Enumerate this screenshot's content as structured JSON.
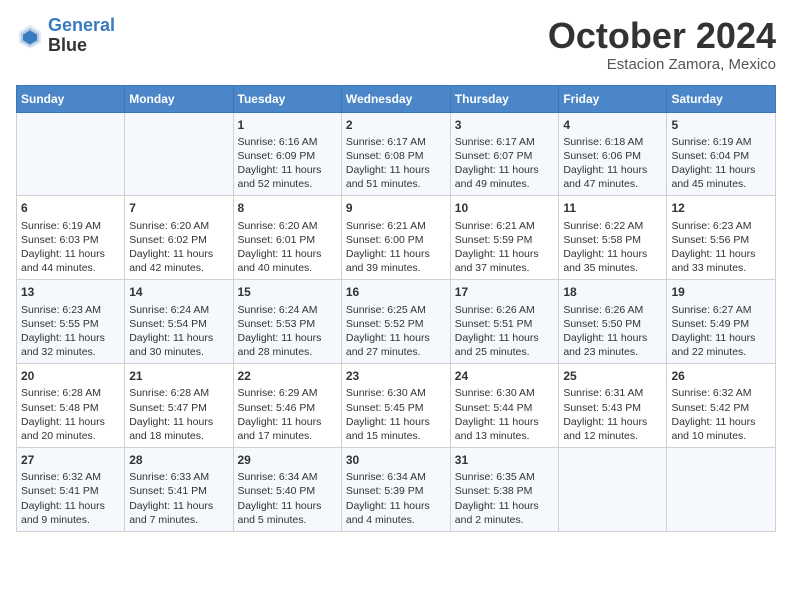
{
  "header": {
    "logo_line1": "General",
    "logo_line2": "Blue",
    "month": "October 2024",
    "location": "Estacion Zamora, Mexico"
  },
  "days_of_week": [
    "Sunday",
    "Monday",
    "Tuesday",
    "Wednesday",
    "Thursday",
    "Friday",
    "Saturday"
  ],
  "weeks": [
    [
      {
        "day": "",
        "content": ""
      },
      {
        "day": "",
        "content": ""
      },
      {
        "day": "1",
        "content": "Sunrise: 6:16 AM\nSunset: 6:09 PM\nDaylight: 11 hours and 52 minutes."
      },
      {
        "day": "2",
        "content": "Sunrise: 6:17 AM\nSunset: 6:08 PM\nDaylight: 11 hours and 51 minutes."
      },
      {
        "day": "3",
        "content": "Sunrise: 6:17 AM\nSunset: 6:07 PM\nDaylight: 11 hours and 49 minutes."
      },
      {
        "day": "4",
        "content": "Sunrise: 6:18 AM\nSunset: 6:06 PM\nDaylight: 11 hours and 47 minutes."
      },
      {
        "day": "5",
        "content": "Sunrise: 6:19 AM\nSunset: 6:04 PM\nDaylight: 11 hours and 45 minutes."
      }
    ],
    [
      {
        "day": "6",
        "content": "Sunrise: 6:19 AM\nSunset: 6:03 PM\nDaylight: 11 hours and 44 minutes."
      },
      {
        "day": "7",
        "content": "Sunrise: 6:20 AM\nSunset: 6:02 PM\nDaylight: 11 hours and 42 minutes."
      },
      {
        "day": "8",
        "content": "Sunrise: 6:20 AM\nSunset: 6:01 PM\nDaylight: 11 hours and 40 minutes."
      },
      {
        "day": "9",
        "content": "Sunrise: 6:21 AM\nSunset: 6:00 PM\nDaylight: 11 hours and 39 minutes."
      },
      {
        "day": "10",
        "content": "Sunrise: 6:21 AM\nSunset: 5:59 PM\nDaylight: 11 hours and 37 minutes."
      },
      {
        "day": "11",
        "content": "Sunrise: 6:22 AM\nSunset: 5:58 PM\nDaylight: 11 hours and 35 minutes."
      },
      {
        "day": "12",
        "content": "Sunrise: 6:23 AM\nSunset: 5:56 PM\nDaylight: 11 hours and 33 minutes."
      }
    ],
    [
      {
        "day": "13",
        "content": "Sunrise: 6:23 AM\nSunset: 5:55 PM\nDaylight: 11 hours and 32 minutes."
      },
      {
        "day": "14",
        "content": "Sunrise: 6:24 AM\nSunset: 5:54 PM\nDaylight: 11 hours and 30 minutes."
      },
      {
        "day": "15",
        "content": "Sunrise: 6:24 AM\nSunset: 5:53 PM\nDaylight: 11 hours and 28 minutes."
      },
      {
        "day": "16",
        "content": "Sunrise: 6:25 AM\nSunset: 5:52 PM\nDaylight: 11 hours and 27 minutes."
      },
      {
        "day": "17",
        "content": "Sunrise: 6:26 AM\nSunset: 5:51 PM\nDaylight: 11 hours and 25 minutes."
      },
      {
        "day": "18",
        "content": "Sunrise: 6:26 AM\nSunset: 5:50 PM\nDaylight: 11 hours and 23 minutes."
      },
      {
        "day": "19",
        "content": "Sunrise: 6:27 AM\nSunset: 5:49 PM\nDaylight: 11 hours and 22 minutes."
      }
    ],
    [
      {
        "day": "20",
        "content": "Sunrise: 6:28 AM\nSunset: 5:48 PM\nDaylight: 11 hours and 20 minutes."
      },
      {
        "day": "21",
        "content": "Sunrise: 6:28 AM\nSunset: 5:47 PM\nDaylight: 11 hours and 18 minutes."
      },
      {
        "day": "22",
        "content": "Sunrise: 6:29 AM\nSunset: 5:46 PM\nDaylight: 11 hours and 17 minutes."
      },
      {
        "day": "23",
        "content": "Sunrise: 6:30 AM\nSunset: 5:45 PM\nDaylight: 11 hours and 15 minutes."
      },
      {
        "day": "24",
        "content": "Sunrise: 6:30 AM\nSunset: 5:44 PM\nDaylight: 11 hours and 13 minutes."
      },
      {
        "day": "25",
        "content": "Sunrise: 6:31 AM\nSunset: 5:43 PM\nDaylight: 11 hours and 12 minutes."
      },
      {
        "day": "26",
        "content": "Sunrise: 6:32 AM\nSunset: 5:42 PM\nDaylight: 11 hours and 10 minutes."
      }
    ],
    [
      {
        "day": "27",
        "content": "Sunrise: 6:32 AM\nSunset: 5:41 PM\nDaylight: 11 hours and 9 minutes."
      },
      {
        "day": "28",
        "content": "Sunrise: 6:33 AM\nSunset: 5:41 PM\nDaylight: 11 hours and 7 minutes."
      },
      {
        "day": "29",
        "content": "Sunrise: 6:34 AM\nSunset: 5:40 PM\nDaylight: 11 hours and 5 minutes."
      },
      {
        "day": "30",
        "content": "Sunrise: 6:34 AM\nSunset: 5:39 PM\nDaylight: 11 hours and 4 minutes."
      },
      {
        "day": "31",
        "content": "Sunrise: 6:35 AM\nSunset: 5:38 PM\nDaylight: 11 hours and 2 minutes."
      },
      {
        "day": "",
        "content": ""
      },
      {
        "day": "",
        "content": ""
      }
    ]
  ]
}
